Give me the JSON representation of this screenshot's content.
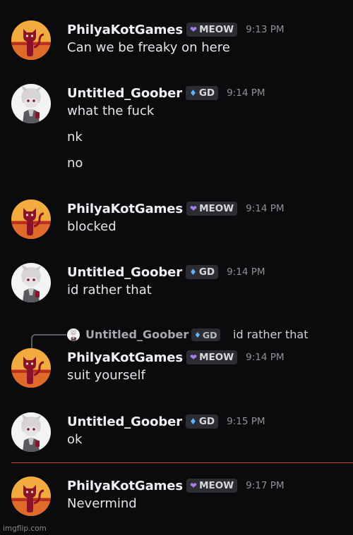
{
  "messages": [
    {
      "user": "PhilyaKotGames",
      "tag": "MEOW",
      "tag_icon": "purple-heart-icon",
      "time": "9:13 PM",
      "lines": [
        "Can we be freaky on here"
      ]
    },
    {
      "user": "Untitled_Goober",
      "tag": "GD",
      "tag_icon": "gem-icon",
      "time": "9:14 PM",
      "lines": [
        "what the fuck",
        "nk",
        "no"
      ]
    },
    {
      "user": "PhilyaKotGames",
      "tag": "MEOW",
      "tag_icon": "purple-heart-icon",
      "time": "9:14 PM",
      "lines": [
        "blocked"
      ]
    },
    {
      "user": "Untitled_Goober",
      "tag": "GD",
      "tag_icon": "gem-icon",
      "time": "9:14 PM",
      "lines": [
        "id rather that"
      ]
    },
    {
      "user": "PhilyaKotGames",
      "tag": "MEOW",
      "tag_icon": "purple-heart-icon",
      "time": "9:14 PM",
      "lines": [
        "suit yourself"
      ]
    },
    {
      "user": "Untitled_Goober",
      "tag": "GD",
      "tag_icon": "gem-icon",
      "time": "9:15 PM",
      "lines": [
        "ok"
      ]
    },
    {
      "user": "PhilyaKotGames",
      "tag": "MEOW",
      "tag_icon": "purple-heart-icon",
      "time": "9:17 PM",
      "lines": [
        "Nevermind"
      ]
    }
  ],
  "reply": {
    "user": "Untitled_Goober",
    "tag": "GD",
    "text": "id rather that"
  },
  "colors": {
    "background": "#0b0b0d",
    "new_messages_divider": "#c0453b",
    "heart": "#a77df0",
    "gem": "#5fb6ff"
  },
  "watermark": "imgflip.com"
}
